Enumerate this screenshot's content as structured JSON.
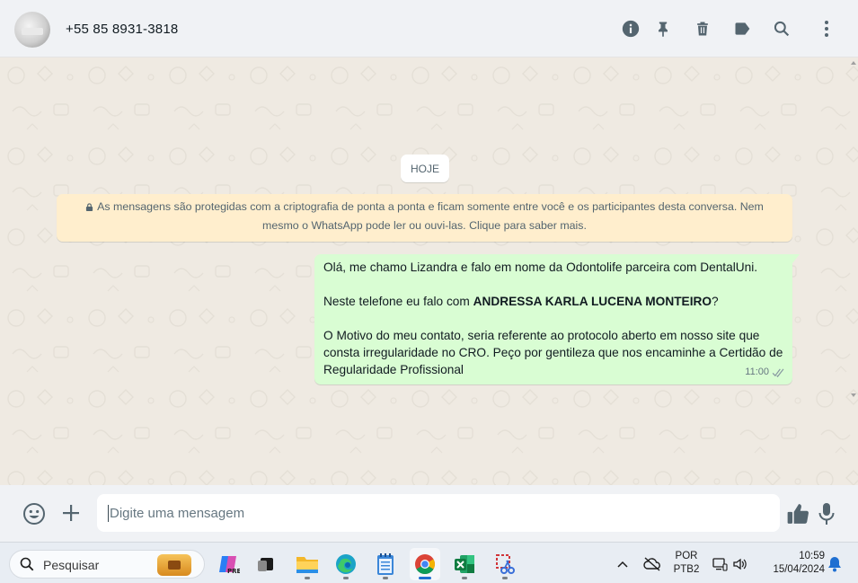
{
  "header": {
    "contact_name": "+55 85 8931-3818",
    "icons": [
      "info-icon",
      "pin-icon",
      "delete-icon",
      "label-icon",
      "search-icon",
      "menu-icon"
    ]
  },
  "chat": {
    "date_chip": "HOJE",
    "encryption_notice": "As mensagens são protegidas com a criptografia de ponta a ponta e ficam somente entre você e os participantes desta conversa. Nem mesmo o WhatsApp pode ler ou ouvi-las. Clique para saber mais.",
    "message": {
      "line1": "Olá, me chamo Lizandra e falo em nome da Odontolife parceira com DentalUni.",
      "line2_prefix": "Neste telefone eu falo com ",
      "line2_bold": "ANDRESSA KARLA LUCENA MONTEIRO",
      "line2_suffix": "?",
      "line3": "O Motivo do meu contato, seria referente ao protocolo aberto em nosso site que consta irregularidade no CRO. Peço por gentileza que nos encaminhe a Certidão de Regularidade Profissional",
      "time": "11:00",
      "status": "read"
    },
    "bubble_color": "#d9fdd3",
    "notice_color": "#ffeecd"
  },
  "composer": {
    "placeholder": "Digite uma mensagem",
    "icons": [
      "emoji-icon",
      "attach-plus-icon",
      "thumbs-up-icon",
      "microphone-icon"
    ]
  },
  "taskbar": {
    "search_placeholder": "Pesquisar",
    "apps": [
      "copilot-icon",
      "task-view-icon",
      "file-explorer-icon",
      "edge-icon",
      "notepad-icon",
      "chrome-icon",
      "excel-icon",
      "snipping-tool-icon"
    ],
    "language_line1": "POR",
    "language_line2": "PTB2",
    "clock_time": "10:59",
    "clock_date": "15/04/2024"
  }
}
